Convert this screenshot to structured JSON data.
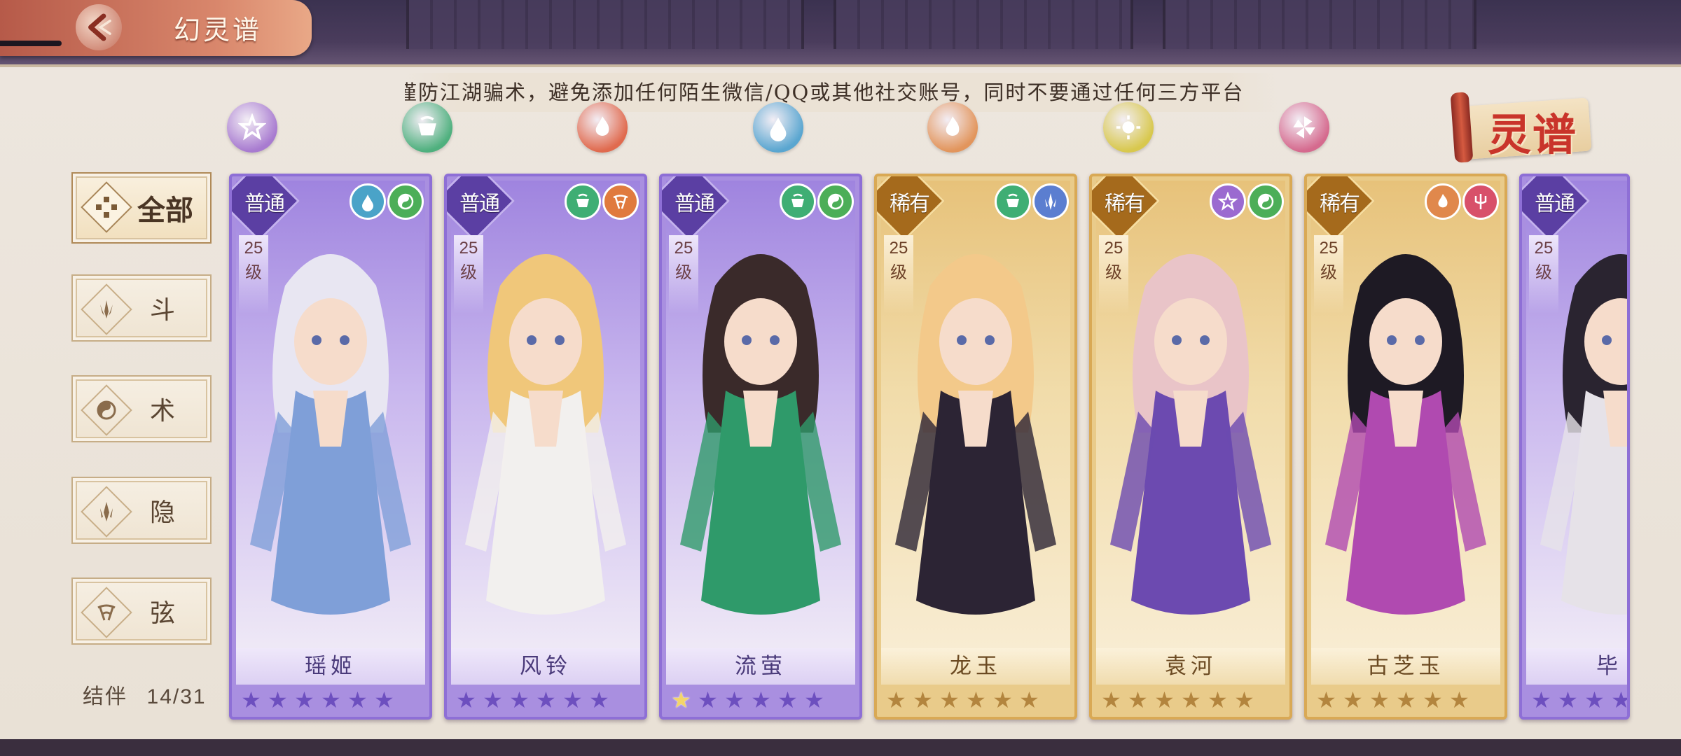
{
  "header": {
    "title": "幻灵谱"
  },
  "notice": "谨防江湖骗术，避免添加任何陌生微信/QQ或其他社交账号，同时不要通过任何三方平台",
  "logo_text": "灵谱",
  "attribute_filters": [
    {
      "name": "attr-filter-shu",
      "color": "#a87bd0"
    },
    {
      "name": "attr-filter-cup",
      "color": "#4fb07e"
    },
    {
      "name": "attr-filter-fire",
      "color": "#e06a4e"
    },
    {
      "name": "attr-filter-water",
      "color": "#5aa6d0"
    },
    {
      "name": "attr-filter-flame",
      "color": "#e2955c"
    },
    {
      "name": "attr-filter-sun",
      "color": "#d8c84e"
    },
    {
      "name": "attr-filter-pinwheel",
      "color": "#d56a8e"
    }
  ],
  "tabs": [
    {
      "label": "全部"
    },
    {
      "label": "斗"
    },
    {
      "label": "术"
    },
    {
      "label": "隐"
    },
    {
      "label": "弦"
    }
  ],
  "bond": {
    "label": "结伴",
    "value": "14/31"
  },
  "cards": [
    {
      "name": "瑶姬",
      "rarity": "普通",
      "rarity_type": "common",
      "level_num": "25",
      "level_unit": "级",
      "stars_lit": 0,
      "stars_total": 6,
      "elements": [
        {
          "icon": "water-icon",
          "color": "#4aa3c8"
        },
        {
          "icon": "yinyang-icon",
          "color": "#4cae58"
        }
      ],
      "hair": "#e8e6f2",
      "outfit": "#7f9fd8"
    },
    {
      "name": "风铃",
      "rarity": "普通",
      "rarity_type": "common",
      "level_num": "25",
      "level_unit": "级",
      "stars_lit": 0,
      "stars_total": 6,
      "elements": [
        {
          "icon": "cup-icon",
          "color": "#3fae74"
        },
        {
          "icon": "string-icon",
          "color": "#e07a3e"
        }
      ],
      "hair": "#f0c77a",
      "outfit": "#f2f0ee"
    },
    {
      "name": "流萤",
      "rarity": "普通",
      "rarity_type": "common",
      "level_num": "25",
      "level_unit": "级",
      "stars_lit": 1,
      "stars_total": 6,
      "elements": [
        {
          "icon": "cup-icon",
          "color": "#3fae74"
        },
        {
          "icon": "yinyang-icon",
          "color": "#4cae58"
        }
      ],
      "hair": "#3a2a2a",
      "outfit": "#2f9a6a"
    },
    {
      "name": "龙玉",
      "rarity": "稀有",
      "rarity_type": "rare",
      "level_num": "25",
      "level_unit": "级",
      "stars_lit": 0,
      "stars_total": 6,
      "elements": [
        {
          "icon": "cup-icon",
          "color": "#3fae74"
        },
        {
          "icon": "blade-icon",
          "color": "#5b7ed0"
        }
      ],
      "hair": "#f3c98a",
      "outfit": "#2c2434"
    },
    {
      "name": "袁河",
      "rarity": "稀有",
      "rarity_type": "rare",
      "level_num": "25",
      "level_unit": "级",
      "stars_lit": 0,
      "stars_total": 6,
      "elements": [
        {
          "icon": "shu-icon",
          "color": "#9b6ad0"
        },
        {
          "icon": "yinyang-icon",
          "color": "#4cae58"
        }
      ],
      "hair": "#e9c4c8",
      "outfit": "#6c4ab0"
    },
    {
      "name": "古芝玉",
      "rarity": "稀有",
      "rarity_type": "rare",
      "level_num": "25",
      "level_unit": "级",
      "stars_lit": 0,
      "stars_total": 6,
      "elements": [
        {
          "icon": "flame-icon",
          "color": "#e0884c"
        },
        {
          "icon": "trident-icon",
          "color": "#d8506a"
        }
      ],
      "hair": "#1e1a24",
      "outfit": "#b04ab0"
    },
    {
      "name": "毕",
      "rarity": "普通",
      "rarity_type": "common",
      "level_num": "25",
      "level_unit": "级",
      "stars_lit": 0,
      "stars_total": 6,
      "elements": [],
      "hair": "#2a2430",
      "outfit": "#e6e2e8"
    }
  ]
}
